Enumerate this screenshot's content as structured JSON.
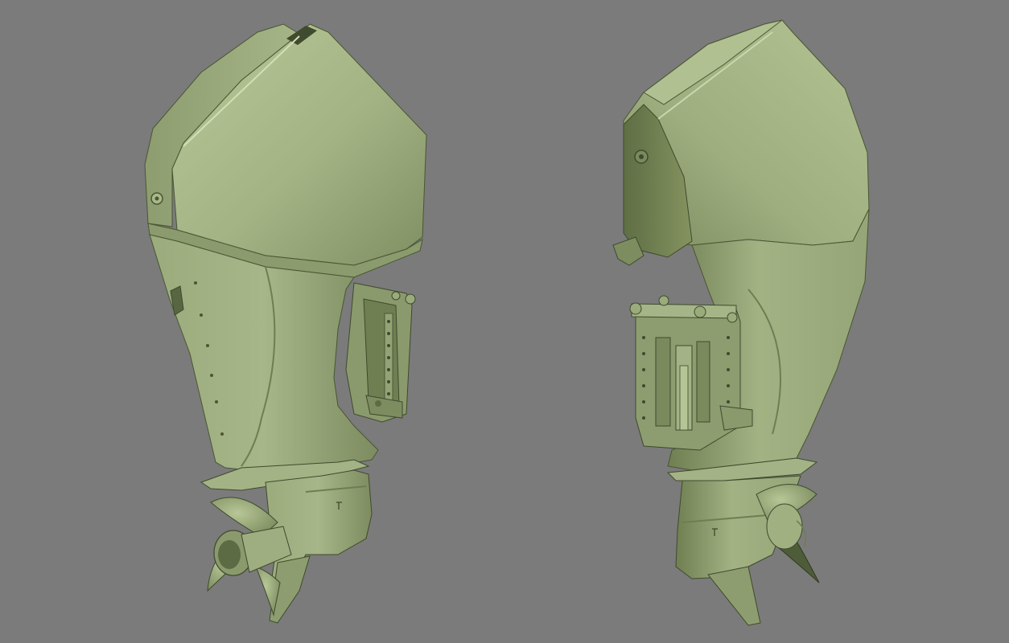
{
  "viewport": {
    "background": "#7b7b7b",
    "render_style": "flat-shaded 3D model",
    "subject": "outboard-motor"
  },
  "materials": {
    "base": "#9aab7c",
    "light": "#b4c494",
    "highlight": "#c9d6ab",
    "shadow": "#6f7f55",
    "deep_shadow": "#4f5c3a",
    "edge": "#3f4a2e"
  },
  "views": [
    {
      "id": "left-view",
      "orientation": "three-quarter-front"
    },
    {
      "id": "right-view",
      "orientation": "three-quarter-rear"
    }
  ]
}
